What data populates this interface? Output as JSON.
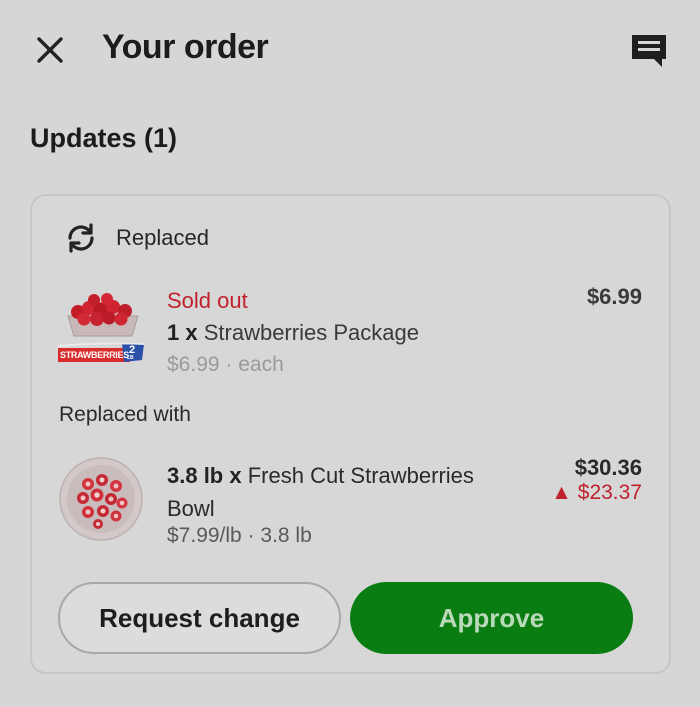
{
  "header": {
    "title": "Your order"
  },
  "updates": {
    "title": "Updates (1)"
  },
  "card": {
    "status_label": "Replaced",
    "original": {
      "status": "Sold out",
      "qty": "1 x",
      "name": "Strawberries Package",
      "unit_price": "$6.99 · each",
      "price": "$6.99",
      "package_label": "STRAWBERRIES",
      "package_size": "2",
      "package_size_unit": "LB"
    },
    "replaced_with_label": "Replaced with",
    "replacement": {
      "qty": "3.8 lb x",
      "name": "Fresh Cut Strawberries Bowl",
      "unit_price": "$7.99/lb · 3.8 lb",
      "price": "$30.36",
      "price_diff": "▲ $23.37"
    },
    "request_change_label": "Request change",
    "approve_label": "Approve"
  },
  "colors": {
    "background": "#d6d6d6",
    "sold_out_red": "#c0212c",
    "approve_green": "#0a7d12"
  },
  "icons": {
    "close": "close-icon",
    "chat": "chat-icon",
    "replace": "refresh-icon"
  }
}
